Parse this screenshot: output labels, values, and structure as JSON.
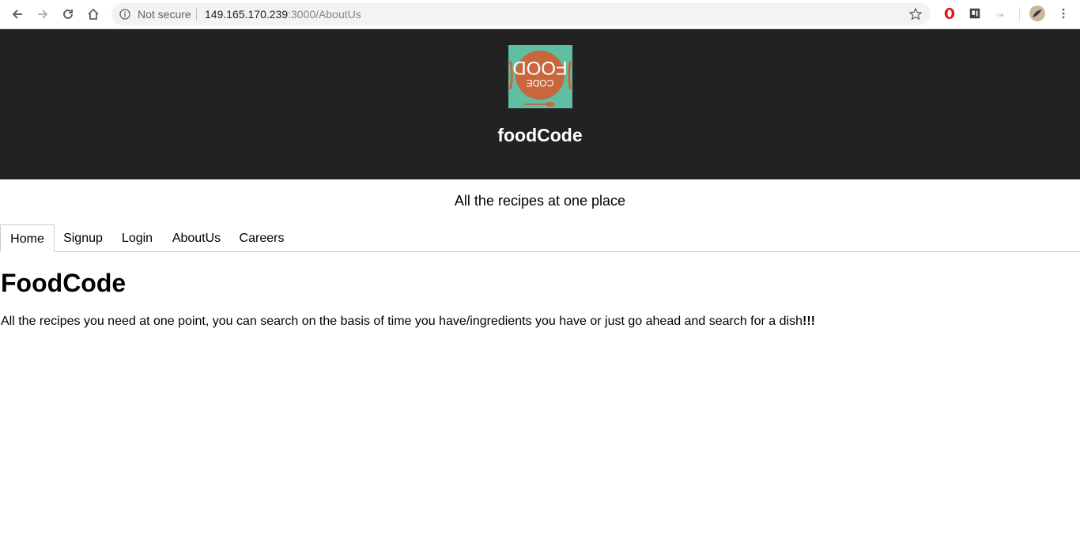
{
  "browser": {
    "security_label": "Not secure",
    "url_host": "149.165.170.239",
    "url_path": ":3000/AboutUs"
  },
  "header": {
    "logo_text": "FOOD CODE",
    "title": "foodCode",
    "background": "#222222",
    "logo_bg": "#5fbfa3",
    "logo_plate": "#c8673e"
  },
  "tagline": "All the recipes at one place",
  "tabs": [
    {
      "label": "Home",
      "active": true
    },
    {
      "label": "Signup",
      "active": false
    },
    {
      "label": "Login",
      "active": false
    },
    {
      "label": "AboutUs",
      "active": false
    },
    {
      "label": "Careers",
      "active": false
    }
  ],
  "main": {
    "heading": "FoodCode",
    "text": "All the recipes you need at one point, you can search on the basis of time you have/ingredients you have or just go ahead and search for a dish",
    "text_emphasis": "!!!"
  }
}
